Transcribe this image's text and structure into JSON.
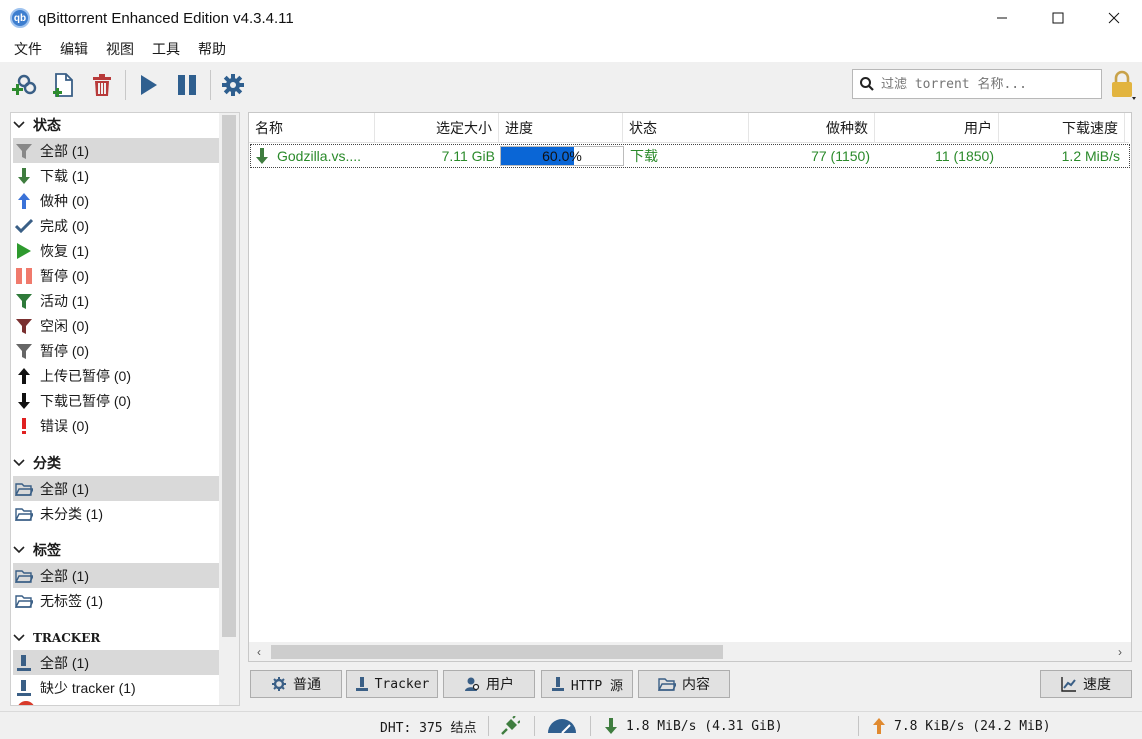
{
  "window": {
    "title": "qBittorrent Enhanced Edition v4.3.4.11",
    "app_icon_text": "qb"
  },
  "menu": [
    "文件",
    "编辑",
    "视图",
    "工具",
    "帮助"
  ],
  "search": {
    "placeholder": "过滤 torrent 名称..."
  },
  "sidebar": {
    "status": {
      "title": "状态",
      "items": [
        {
          "label": "全部 (1)",
          "icon": "filter-icon",
          "selected": true
        },
        {
          "label": "下载 (1)",
          "icon": "download-arrow-icon"
        },
        {
          "label": "做种 (0)",
          "icon": "upload-arrow-icon"
        },
        {
          "label": "完成 (0)",
          "icon": "checkmark-icon"
        },
        {
          "label": "恢复 (1)",
          "icon": "play-icon"
        },
        {
          "label": "暂停 (0)",
          "icon": "pause-icon"
        },
        {
          "label": "活动 (1)",
          "icon": "filter-green-icon"
        },
        {
          "label": "空闲 (0)",
          "icon": "filter-red-icon"
        },
        {
          "label": "暂停 (0)",
          "icon": "filter-gray-icon"
        },
        {
          "label": "上传已暂停 (0)",
          "icon": "upload-stalled-icon"
        },
        {
          "label": "下载已暂停 (0)",
          "icon": "download-stalled-icon"
        },
        {
          "label": "错误 (0)",
          "icon": "error-icon"
        }
      ]
    },
    "categories": {
      "title": "分类",
      "items": [
        {
          "label": "全部 (1)",
          "icon": "folder-icon",
          "selected": true
        },
        {
          "label": "未分类 (1)",
          "icon": "folder-icon"
        }
      ]
    },
    "tags": {
      "title": "标签",
      "items": [
        {
          "label": "全部 (1)",
          "icon": "folder-icon",
          "selected": true
        },
        {
          "label": "无标签 (1)",
          "icon": "folder-icon"
        }
      ]
    },
    "trackers": {
      "title": "TRACKER",
      "items": [
        {
          "label": "全部 (1)",
          "icon": "tracker-icon",
          "selected": true
        },
        {
          "label": "缺少 tracker (1)",
          "icon": "tracker-icon"
        }
      ]
    }
  },
  "table": {
    "columns": [
      "名称",
      "选定大小",
      "进度",
      "状态",
      "做种数",
      "用户",
      "下载速度"
    ],
    "rows": [
      {
        "name": "Godzilla.vs....",
        "size": "7.11 GiB",
        "progress_text": "60.0%",
        "progress": 0.6,
        "status": "下载",
        "seeds": "77 (1150)",
        "peers": "11 (1850)",
        "down_speed": "1.2 MiB/s"
      }
    ]
  },
  "tabs": {
    "general": "普通",
    "trackers": "Tracker",
    "peers": "用户",
    "http_sources": "HTTP 源",
    "content": "内容",
    "speed": "速度"
  },
  "statusbar": {
    "dht": "DHT: 375 结点",
    "download": "1.8 MiB/s (4.31 GiB)",
    "upload": "7.8 KiB/s (24.2 MiB)"
  },
  "colors": {
    "accent": "#0a66d6",
    "downloading_text": "#2a8a2a",
    "selected_row": "#d9d9d9"
  }
}
